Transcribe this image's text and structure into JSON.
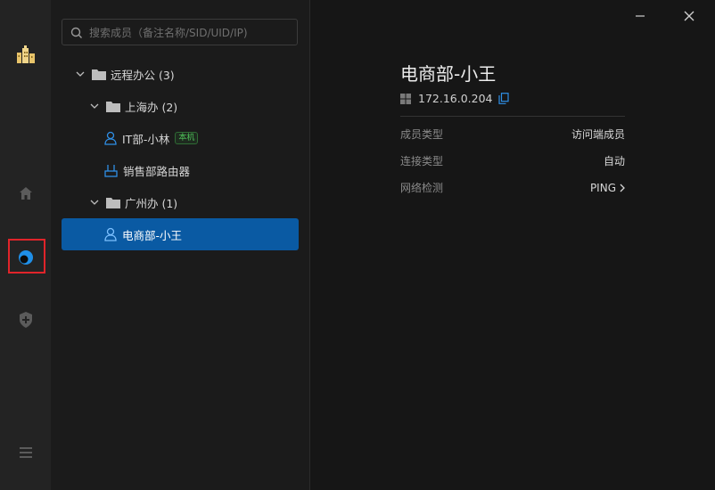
{
  "search": {
    "placeholder": "搜索成员（备注名称/SID/UID/IP)"
  },
  "tree": {
    "root": {
      "label": "远程办公 (3)"
    },
    "group_shanghai": {
      "label": "上海办 (2)"
    },
    "member_it": {
      "label": "IT部-小林",
      "badge": "本机"
    },
    "member_router": {
      "label": "销售部路由器"
    },
    "group_guangzhou": {
      "label": "广州办 (1)"
    },
    "member_ecom": {
      "label": "电商部-小王"
    }
  },
  "detail": {
    "title": "电商部-小王",
    "ip": "172.16.0.204",
    "rows": [
      {
        "key": "成员类型",
        "value": "访问端成员"
      },
      {
        "key": "连接类型",
        "value": "自动"
      },
      {
        "key": "网络检测",
        "value": "PING"
      }
    ]
  },
  "colors": {
    "accent": "#0a5aa3",
    "selection_outline": "#e0242a",
    "badge_green": "#4fc25a"
  }
}
